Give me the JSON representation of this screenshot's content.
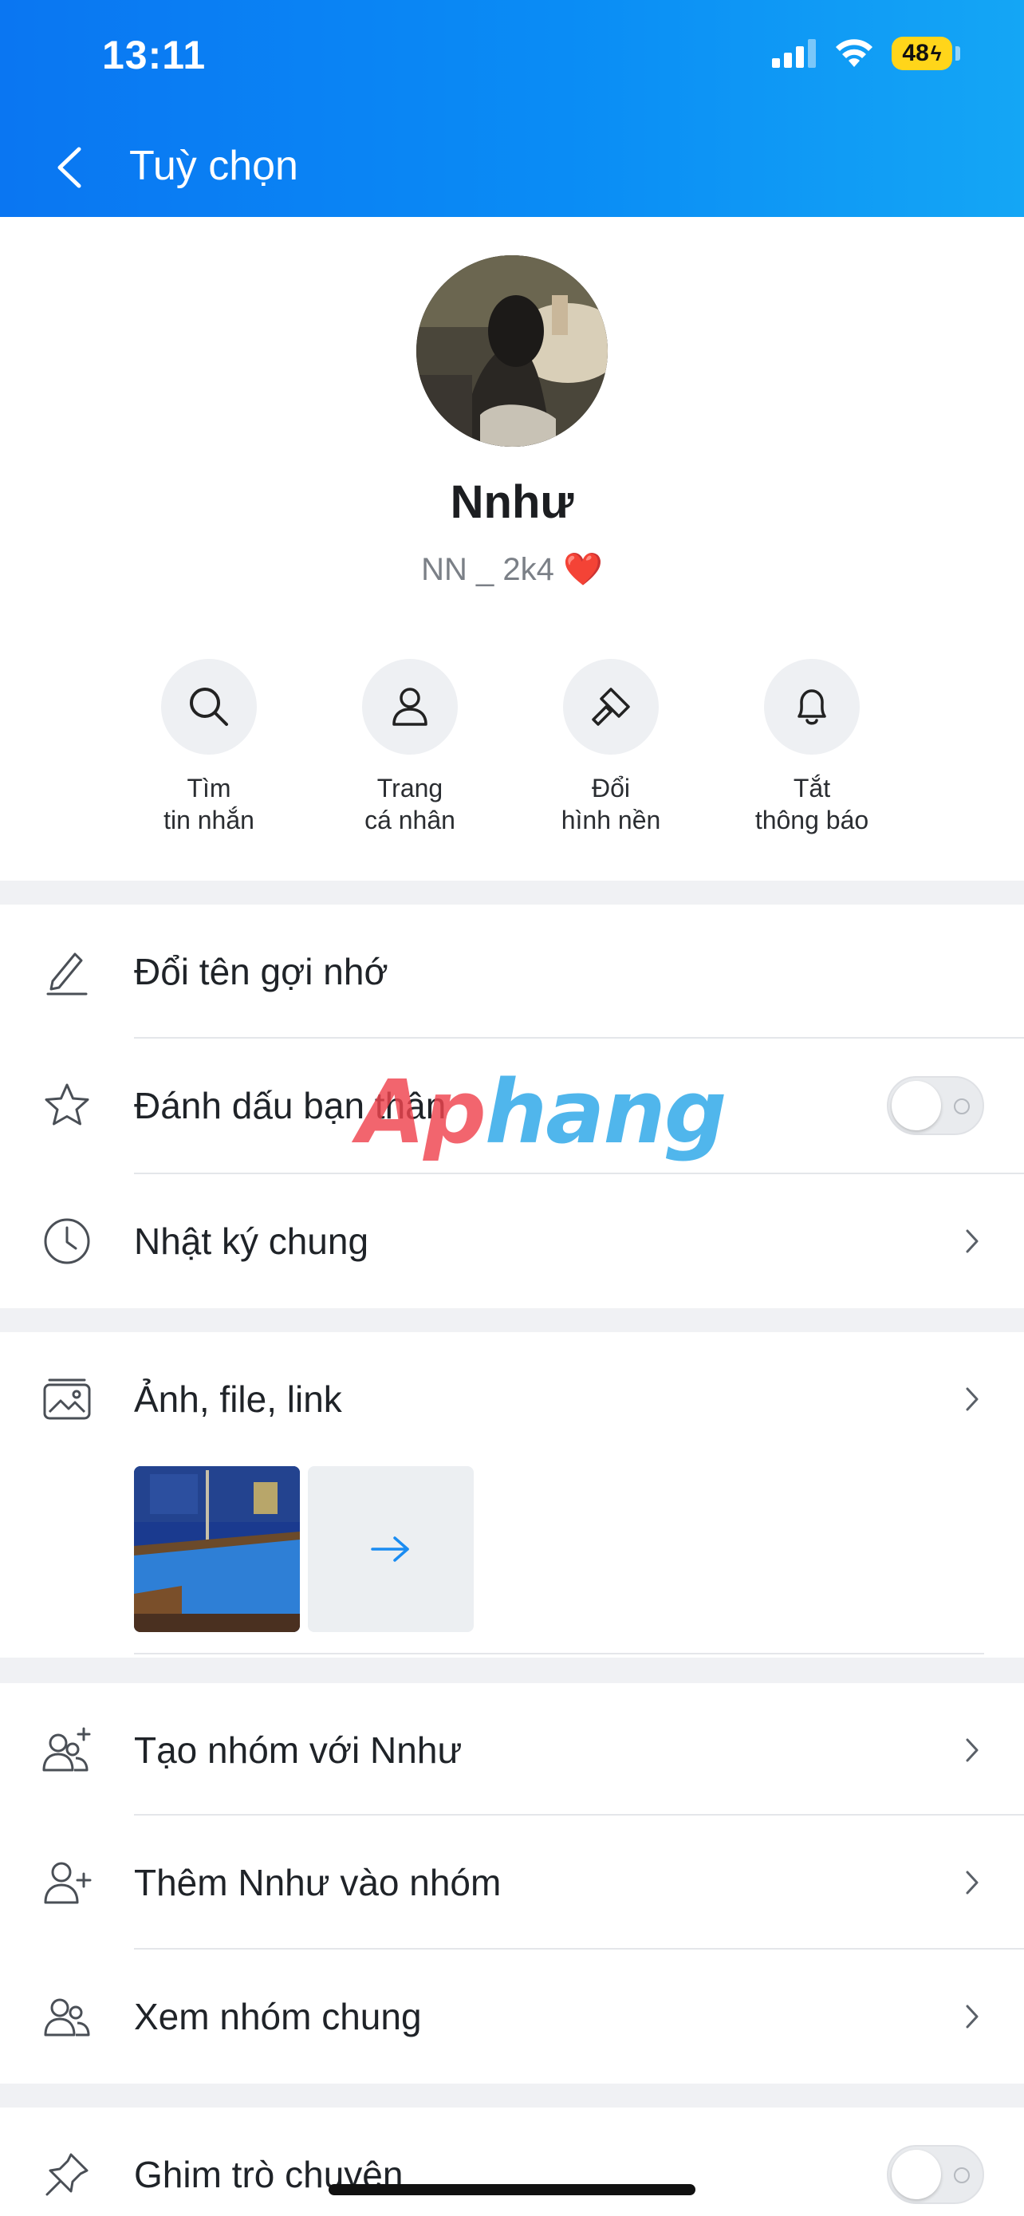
{
  "status_bar": {
    "time": "13:11",
    "battery": "48"
  },
  "header": {
    "title": "Tuỳ chọn"
  },
  "profile": {
    "name": "Nnhư",
    "subtitle": "NN _ 2k4 ❤️"
  },
  "quick_actions": [
    {
      "line1": "Tìm",
      "line2": "tin nhắn",
      "icon": "search-icon"
    },
    {
      "line1": "Trang",
      "line2": "cá nhân",
      "icon": "user-icon"
    },
    {
      "line1": "Đổi",
      "line2": "hình nền",
      "icon": "paint-brush-icon"
    },
    {
      "line1": "Tắt",
      "line2": "thông báo",
      "icon": "bell-icon"
    }
  ],
  "rows": {
    "rename": "Đổi tên gợi nhớ",
    "best_friend": "Đánh dấu bạn thân",
    "shared_diary": "Nhật ký chung",
    "media": "Ảnh, file, link",
    "create_group": "Tạo nhóm với Nnhư",
    "add_to_group": "Thêm Nnhư vào nhóm",
    "common_groups": "Xem nhóm chung",
    "pin_chat": "Ghim trò chuyện"
  },
  "toggles": {
    "best_friend": false,
    "pin_chat": false
  },
  "watermark": {
    "part1": "Ap",
    "part2": "hang"
  },
  "colors": {
    "header_start": "#0a76f2",
    "header_end": "#14a6f5",
    "accent": "#1a8cf2"
  }
}
